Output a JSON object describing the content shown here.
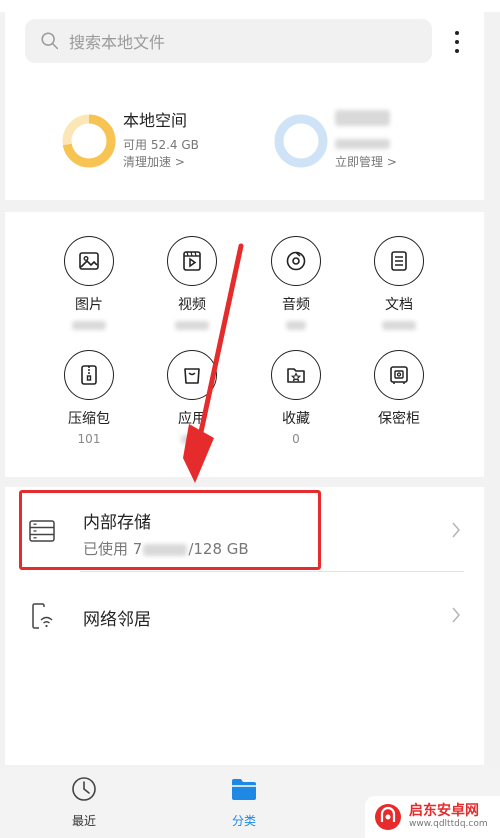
{
  "search": {
    "placeholder": "搜索本地文件"
  },
  "storage": {
    "local": {
      "title": "本地空间",
      "available": "可用 52.4 GB",
      "action": "清理加速 >"
    },
    "cloud": {
      "action": "立即管理 >"
    }
  },
  "categories": [
    {
      "label": "图片",
      "icon": "image-icon"
    },
    {
      "label": "视频",
      "icon": "video-icon"
    },
    {
      "label": "音频",
      "icon": "audio-icon"
    },
    {
      "label": "文档",
      "icon": "document-icon"
    },
    {
      "label": "压缩包",
      "count": "101",
      "icon": "zip-icon"
    },
    {
      "label": "应用",
      "icon": "app-icon"
    },
    {
      "label": "收藏",
      "count": "0",
      "icon": "favorite-icon"
    },
    {
      "label": "保密柜",
      "icon": "safe-icon"
    }
  ],
  "list": {
    "internal": {
      "title": "内部存储",
      "usage_prefix": "已使用 7",
      "usage_suffix": "/128 GB"
    },
    "network": {
      "title": "网络邻居"
    }
  },
  "nav": {
    "recent": "最近",
    "category": "分类"
  },
  "watermark": {
    "name": "启东安卓网",
    "url": "www.qdlttdq.com"
  },
  "colors": {
    "accent": "#1e88e5",
    "annotation": "#e52b2b",
    "ring_local": "#f7c453",
    "ring_cloud": "#cfe3f7"
  }
}
